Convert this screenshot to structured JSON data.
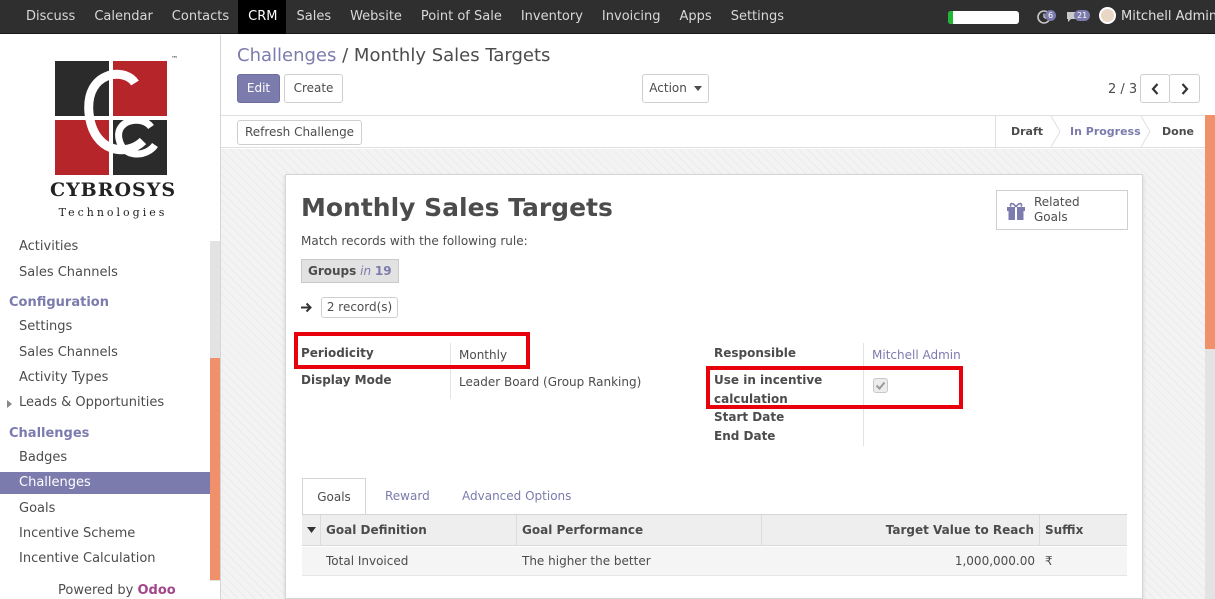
{
  "topnav": {
    "menu": [
      "Discuss",
      "Calendar",
      "Contacts",
      "CRM",
      "Sales",
      "Website",
      "Point of Sale",
      "Inventory",
      "Invoicing",
      "Apps",
      "Settings"
    ],
    "active": "CRM",
    "progress_fraction": 0.07,
    "activity_count": "6",
    "message_count": "21",
    "user_name": "Mitchell Admin",
    "icons": [
      "clock-icon",
      "chat-icon",
      "avatar"
    ]
  },
  "sidebar": {
    "logo_brand": "CYBROSYS",
    "logo_sub": "Technologies",
    "logo_tm": "™",
    "items_top": [
      "Activities",
      "Sales Channels"
    ],
    "configuration_label": "Configuration",
    "configuration_items": [
      "Settings",
      "Sales Channels",
      "Activity Types",
      "Leads & Opportunities"
    ],
    "challenges_label": "Challenges",
    "challenges_items": [
      "Badges",
      "Challenges",
      "Goals",
      "Incentive Scheme",
      "Incentive Calculation"
    ],
    "selected": "Challenges",
    "powered_by": "Powered by",
    "powered_brand": "Odoo"
  },
  "breadcrumb": {
    "parent": "Challenges",
    "separator": "/",
    "current": "Monthly Sales Targets"
  },
  "toolbar": {
    "edit_label": "Edit",
    "create_label": "Create",
    "action_label": "Action",
    "pager": "2 / 3"
  },
  "statusbar": {
    "refresh_label": "Refresh Challenge",
    "stages": [
      "Draft",
      "In Progress",
      "Done"
    ],
    "current_stage": "In Progress"
  },
  "form": {
    "title": "Monthly Sales Targets",
    "rule_text": "Match records with the following rule:",
    "groups_label": "Groups",
    "groups_in": "in",
    "groups_count": "19",
    "records_label": "2 record(s)",
    "related_goals_line1": "Related",
    "related_goals_line2": "Goals",
    "periodicity_label": "Periodicity",
    "periodicity_value": "Monthly",
    "display_mode_label": "Display Mode",
    "display_mode_value": "Leader Board (Group Ranking)",
    "responsible_label": "Responsible",
    "responsible_value": "Mitchell Admin",
    "incentive_label_1": "Use in incentive",
    "incentive_label_2": "calculation",
    "incentive_checked": true,
    "start_date_label": "Start Date",
    "end_date_label": "End Date"
  },
  "tabs": [
    "Goals",
    "Reward",
    "Advanced Options"
  ],
  "active_tab": "Goals",
  "goals_table": {
    "columns": [
      "Goal Definition",
      "Goal Performance",
      "Target Value to Reach",
      "Suffix"
    ],
    "rows": [
      [
        "Total Invoiced",
        "The higher the better",
        "1,000,000.00",
        "₹"
      ]
    ]
  },
  "colors": {
    "accent": "#7c7bad",
    "highlight_box": "#e8000b",
    "scroll_orange": "#f0916b",
    "progress_green": "#21b631"
  }
}
